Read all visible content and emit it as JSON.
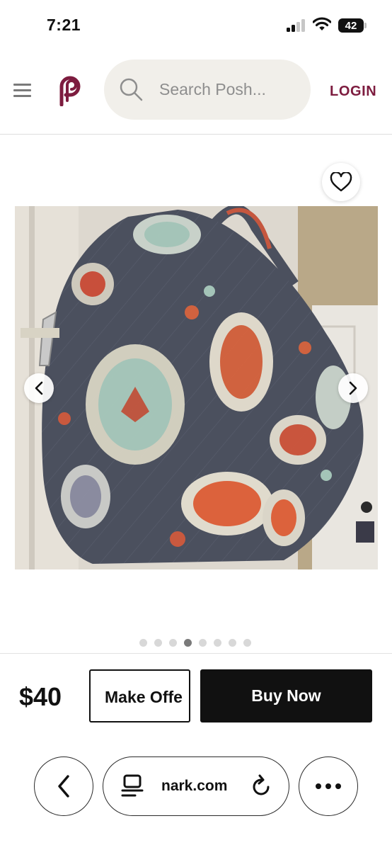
{
  "status_bar": {
    "time": "7:21",
    "battery": "42"
  },
  "header": {
    "search_placeholder": "Search Posh...",
    "login_label": "LOGIN",
    "brand_color": "#7d1c3f"
  },
  "product": {
    "carousel": {
      "total_images": 8,
      "active_index": 3
    }
  },
  "purchase": {
    "price": "$40",
    "offer_label": "Make Offe",
    "buy_label": "Buy Now"
  },
  "browser": {
    "url": "nark.com"
  },
  "icons": {
    "menu": "hamburger-icon",
    "logo": "poshmark-logo",
    "search": "search-icon",
    "like": "heart-icon",
    "prev": "chevron-left-icon",
    "next": "chevron-right-icon",
    "back": "back-arrow-icon",
    "reader": "reader-mode-icon",
    "reload": "reload-icon",
    "more": "more-icon"
  }
}
